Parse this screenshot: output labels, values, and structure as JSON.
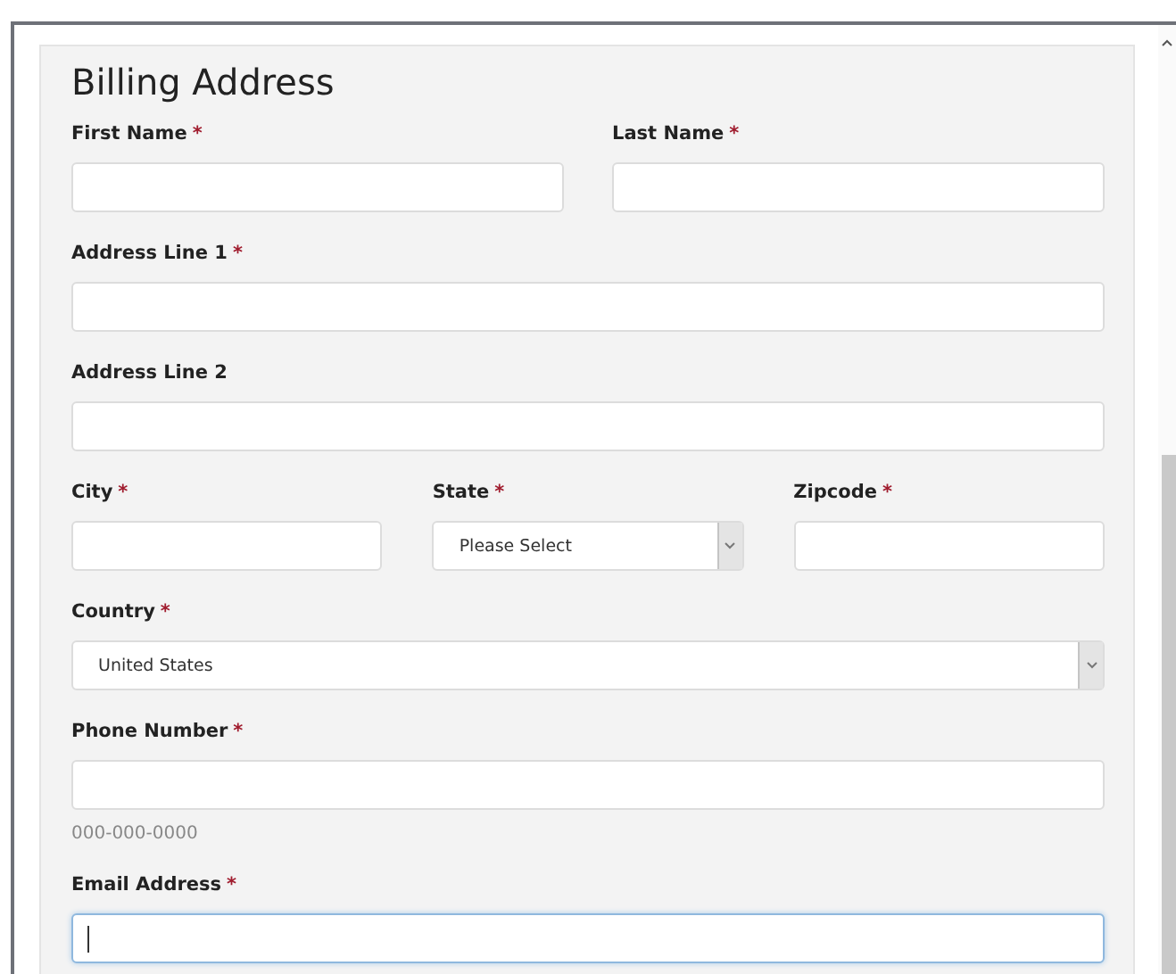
{
  "form": {
    "title": "Billing Address",
    "rows": [
      {
        "fields": [
          {
            "kind": "text",
            "label": "First Name",
            "marker": "*",
            "focused": false
          },
          {
            "kind": "text",
            "label": "Last Name",
            "marker": "*",
            "focused": false
          }
        ]
      },
      {
        "fields": [
          {
            "kind": "text",
            "label": "Address Line 1",
            "marker": "*",
            "focused": false
          }
        ]
      },
      {
        "fields": [
          {
            "kind": "text",
            "label": "Address Line 2",
            "focused": false
          }
        ]
      },
      {
        "fields": [
          {
            "kind": "text",
            "label": "City",
            "marker": "*",
            "focused": false
          },
          {
            "kind": "select",
            "label": "State",
            "marker": "*",
            "value": "Please Select",
            "focused": false
          },
          {
            "kind": "text",
            "label": "Zipcode",
            "marker": "*",
            "focused": false
          }
        ]
      },
      {
        "fields": [
          {
            "kind": "select",
            "label": "Country",
            "marker": "*",
            "value": "United States",
            "focused": false
          }
        ]
      },
      {
        "fields": [
          {
            "kind": "text",
            "label": "Phone Number",
            "marker": "*",
            "hint": "000-000-0000",
            "focused": false
          }
        ]
      },
      {
        "fields": [
          {
            "kind": "text",
            "label": "Email Address",
            "marker": "*",
            "focused": true
          }
        ]
      }
    ]
  }
}
